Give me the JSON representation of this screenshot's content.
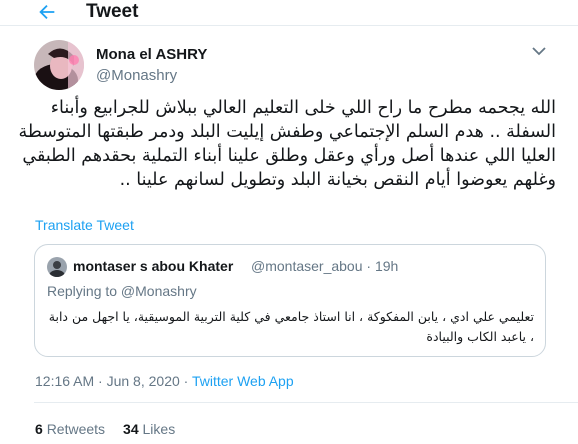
{
  "header": {
    "title": "Tweet",
    "back_icon": "arrow-left-icon"
  },
  "colors": {
    "accent": "#1da1f2",
    "muted": "#657786",
    "text": "#14171a"
  },
  "tweet": {
    "author_name": "Mona el ASHRY",
    "author_handle": "@Monashry",
    "more_icon": "chevron-down-icon",
    "text_lines": [
      "الله يجحمه مطرح ما راح اللي خلى التعليم العالي ببلاش للجرابيع وأبناء",
      "السفلة .. هدم السلم الإجتماعي وطفش إيليت البلد ودمر طبقتها المتوسطة",
      "العليا اللي عندها أصل ورأي وعقل وطلق علينا أبناء التملية بحقدهم الطبقي",
      "وغلهم يعوضوا أيام النقص بخيانة البلد وتطويل لسانهم علينا .."
    ],
    "translate_label": "Translate Tweet",
    "time": "12:16 AM · Jun 8, 2020 · ",
    "source": "Twitter Web App",
    "retweets_count": "6",
    "retweets_label": "Retweets",
    "likes_count": "34",
    "likes_label": "Likes"
  },
  "quote": {
    "author_name": "montaser s abou Khater",
    "author_handle": "@montaser_abou · 19h",
    "replying_to": "Replying to @Monashry",
    "text_lines": [
      "تعليمي علي ادي ، يابن المفكوكة ، انا استاذ جامعي في كلية التربية الموسيقية، يا اجهل من دابة",
      "، ياعبد الكاب والبيادة"
    ]
  }
}
